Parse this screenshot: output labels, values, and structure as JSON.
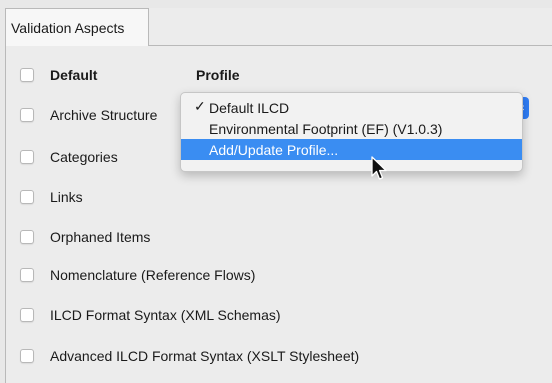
{
  "tab": {
    "label": "Validation Aspects"
  },
  "header": {
    "default_label": "Default",
    "profile_label": "Profile"
  },
  "aspects": [
    {
      "label": "Archive Structure"
    },
    {
      "label": "Categories"
    },
    {
      "label": "Links"
    },
    {
      "label": "Orphaned Items"
    },
    {
      "label": "Nomenclature (Reference Flows)"
    },
    {
      "label": "ILCD Format Syntax (XML Schemas)"
    },
    {
      "label": "Advanced ILCD Format Syntax (XSLT Stylesheet)"
    }
  ],
  "profile_menu": {
    "items": [
      {
        "label": "Default ILCD",
        "checked": true
      },
      {
        "label": "Environmental Footprint (EF) (V1.0.3)",
        "checked": false
      },
      {
        "label": "Add/Update Profile...",
        "highlighted": true
      }
    ],
    "check_glyph": "✓"
  },
  "colors": {
    "accent": "#3a8df2",
    "select_button": "#2f7df6"
  },
  "icons": {
    "cursor": "arrow-pointer-icon",
    "select": "chevron-up-down-icon"
  }
}
